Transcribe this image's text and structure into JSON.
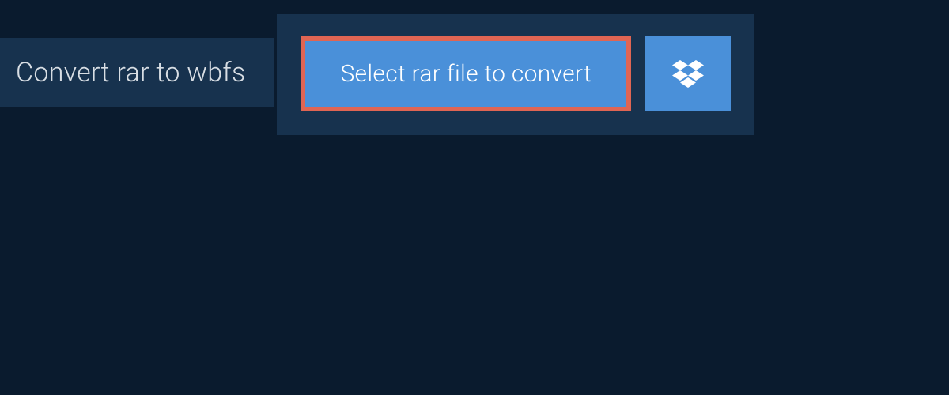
{
  "header": {
    "title": "Convert rar to wbfs"
  },
  "actions": {
    "select_label": "Select rar file to convert",
    "dropbox_icon_name": "dropbox-icon"
  },
  "colors": {
    "page_bg": "#0a1b2e",
    "panel_bg": "#17324e",
    "button_bg": "#4a90d9",
    "button_border": "#e06553",
    "text_light": "#d8dee4",
    "text_white": "#ffffff"
  }
}
